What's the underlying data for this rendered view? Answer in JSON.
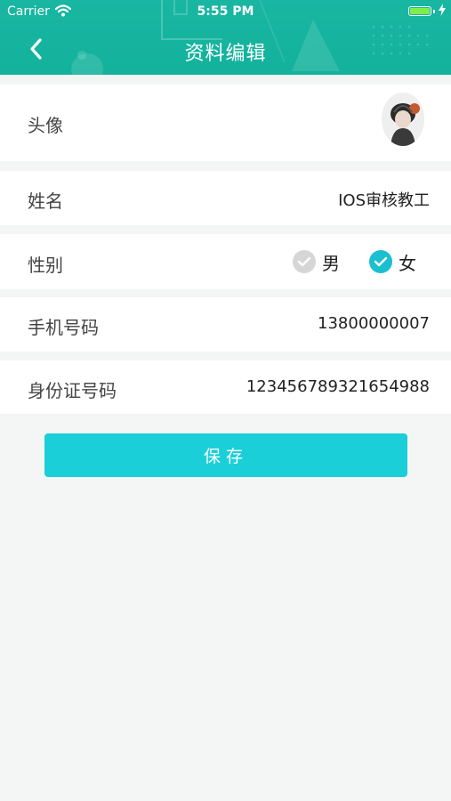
{
  "status_bar": {
    "carrier": "Carrier",
    "time": "5:55 PM"
  },
  "nav": {
    "title": "资料编辑",
    "back_icon": "chevron-left-icon"
  },
  "profile": {
    "avatar_label": "头像",
    "name_label": "姓名",
    "name_value": "IOS审核教工",
    "gender_label": "性别",
    "gender_options": [
      {
        "label": "男",
        "selected": false
      },
      {
        "label": "女",
        "selected": true
      }
    ],
    "phone_label": "手机号码",
    "phone_value": "13800000007",
    "id_label": "身份证号码",
    "id_value": "123456789321654988"
  },
  "save_label": "保存",
  "colors": {
    "header": "#16b49f",
    "accent": "#1bcfd8",
    "background": "#f4f6f6",
    "unchecked": "#d6d6d6",
    "checked": "#1bbfd0"
  }
}
